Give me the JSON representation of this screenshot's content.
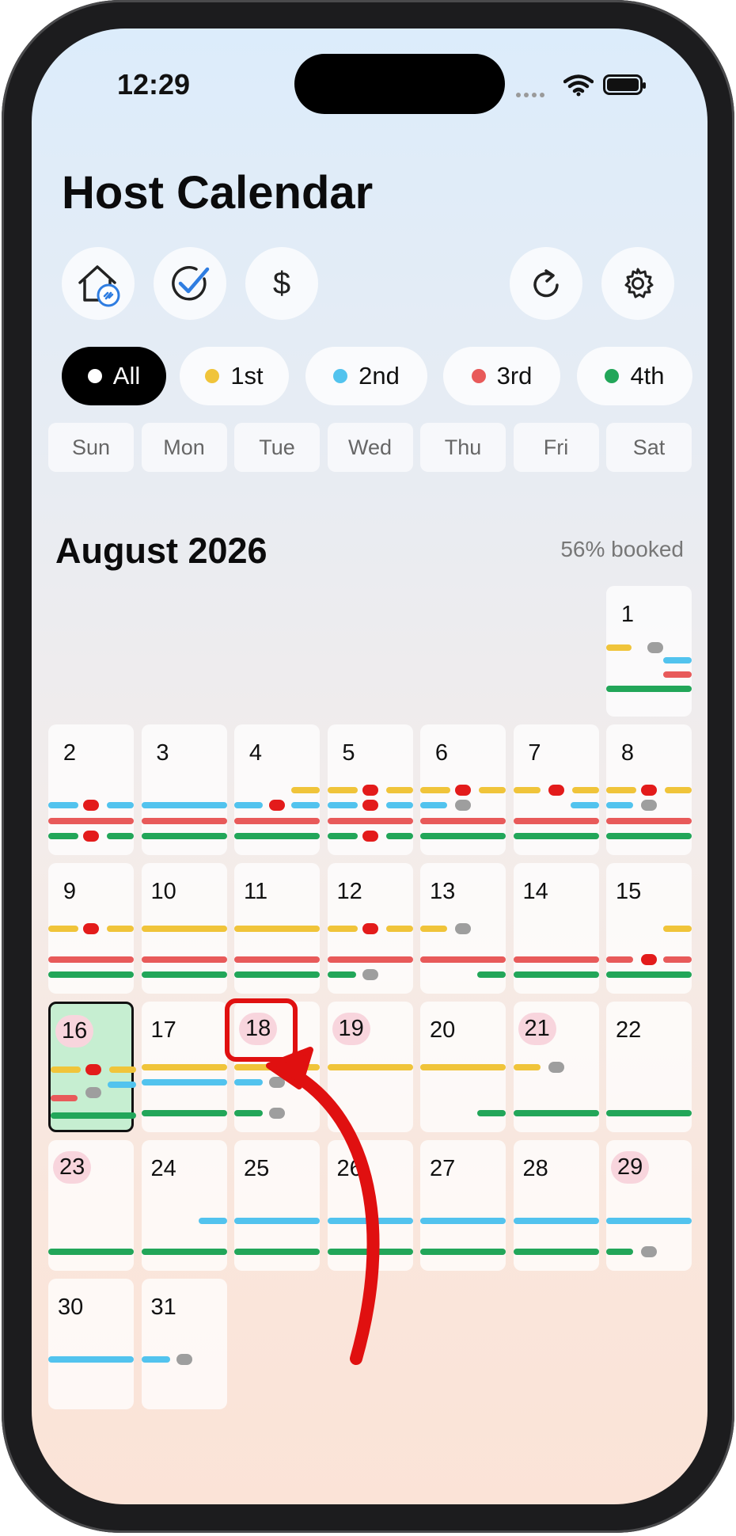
{
  "status": {
    "time": "12:29"
  },
  "header": {
    "title": "Host Calendar"
  },
  "toolbar": {
    "dollar_label": "$"
  },
  "filters": [
    {
      "label": "All",
      "color": "#ffffff",
      "active": true
    },
    {
      "label": "1st",
      "color": "#f0c43a",
      "active": false
    },
    {
      "label": "2nd",
      "color": "#52c3ee",
      "active": false
    },
    {
      "label": "3rd",
      "color": "#e85a5a",
      "active": false
    },
    {
      "label": "4th",
      "color": "#22a659",
      "active": false
    }
  ],
  "weekdays": [
    "Sun",
    "Mon",
    "Tue",
    "Wed",
    "Thu",
    "Fri",
    "Sat"
  ],
  "month": {
    "title": "August 2026",
    "booked": "56% booked"
  },
  "colors": {
    "property_1": "#f0c43a",
    "property_2": "#52c3ee",
    "property_3": "#e85a5a",
    "property_4": "#22a659",
    "turnover_pill": "#9e9e9e",
    "overlap_pill": "#e31b1b",
    "highlight": "#e01010",
    "today_fill": "#c6eed1"
  },
  "days": [
    {
      "day": "1",
      "weekday": 6,
      "pink": false
    },
    {
      "day": "2",
      "weekday": 0,
      "pink": false
    },
    {
      "day": "3",
      "weekday": 1,
      "pink": false
    },
    {
      "day": "4",
      "weekday": 2,
      "pink": false
    },
    {
      "day": "5",
      "weekday": 3,
      "pink": false
    },
    {
      "day": "6",
      "weekday": 4,
      "pink": false
    },
    {
      "day": "7",
      "weekday": 5,
      "pink": false
    },
    {
      "day": "8",
      "weekday": 6,
      "pink": false
    },
    {
      "day": "9",
      "weekday": 0,
      "pink": false
    },
    {
      "day": "10",
      "weekday": 1,
      "pink": false
    },
    {
      "day": "11",
      "weekday": 2,
      "pink": false
    },
    {
      "day": "12",
      "weekday": 3,
      "pink": false
    },
    {
      "day": "13",
      "weekday": 4,
      "pink": false
    },
    {
      "day": "14",
      "weekday": 5,
      "pink": false
    },
    {
      "day": "15",
      "weekday": 6,
      "pink": false
    },
    {
      "day": "16",
      "weekday": 0,
      "pink": true,
      "today": true
    },
    {
      "day": "17",
      "weekday": 1,
      "pink": false
    },
    {
      "day": "18",
      "weekday": 2,
      "pink": true
    },
    {
      "day": "19",
      "weekday": 3,
      "pink": true
    },
    {
      "day": "20",
      "weekday": 4,
      "pink": false
    },
    {
      "day": "21",
      "weekday": 5,
      "pink": true
    },
    {
      "day": "22",
      "weekday": 6,
      "pink": false
    },
    {
      "day": "23",
      "weekday": 0,
      "pink": true
    },
    {
      "day": "24",
      "weekday": 1,
      "pink": false
    },
    {
      "day": "25",
      "weekday": 2,
      "pink": false
    },
    {
      "day": "26",
      "weekday": 3,
      "pink": false
    },
    {
      "day": "27",
      "weekday": 4,
      "pink": false
    },
    {
      "day": "28",
      "weekday": 5,
      "pink": false
    },
    {
      "day": "29",
      "weekday": 6,
      "pink": true
    },
    {
      "day": "30",
      "weekday": 0,
      "pink": false
    },
    {
      "day": "31",
      "weekday": 1,
      "pink": false
    }
  ]
}
